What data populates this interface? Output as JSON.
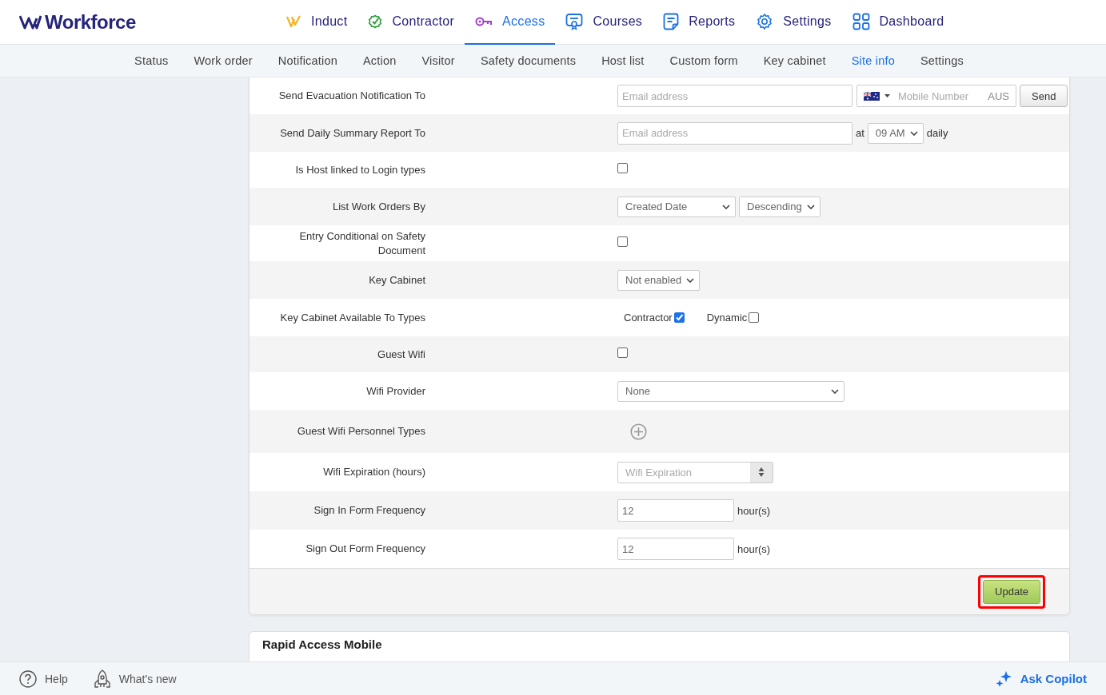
{
  "brand": {
    "name": "Workforce"
  },
  "top_nav": [
    {
      "kind": "induct",
      "label": "Induct",
      "selected": false
    },
    {
      "kind": "contractor",
      "label": "Contractor",
      "selected": false
    },
    {
      "kind": "access",
      "label": "Access",
      "selected": true
    },
    {
      "kind": "courses",
      "label": "Courses",
      "selected": false
    },
    {
      "kind": "reports",
      "label": "Reports",
      "selected": false
    },
    {
      "kind": "settings",
      "label": "Settings",
      "selected": false
    },
    {
      "kind": "dashboard",
      "label": "Dashboard",
      "selected": false
    }
  ],
  "sub_nav": [
    {
      "label": "Status",
      "selected": false
    },
    {
      "label": "Work order",
      "selected": false
    },
    {
      "label": "Notification",
      "selected": false
    },
    {
      "label": "Action",
      "selected": false
    },
    {
      "label": "Visitor",
      "selected": false
    },
    {
      "label": "Safety documents",
      "selected": false
    },
    {
      "label": "Host list",
      "selected": false
    },
    {
      "label": "Custom form",
      "selected": false
    },
    {
      "label": "Key cabinet",
      "selected": false
    },
    {
      "label": "Site info",
      "selected": true
    },
    {
      "label": "Settings",
      "selected": false
    }
  ],
  "form": {
    "rows": [
      {
        "kind": "email_phone",
        "label": "Send Evacuation Notification To",
        "email_placeholder": "Email address",
        "phone_placeholder": "Mobile Number",
        "country": "AUS",
        "button": "Send"
      },
      {
        "kind": "email_time",
        "label": "Send Daily Summary Report To",
        "email_placeholder": "Email address",
        "prefix": "at",
        "time": "09 AM",
        "suffix": "daily"
      },
      {
        "kind": "checkbox",
        "label": "Is Host linked to Login types",
        "checked": false
      },
      {
        "kind": "selects",
        "label": "List Work Orders By",
        "values": [
          "Created Date",
          "Descending"
        ]
      },
      {
        "kind": "checkbox",
        "label": "Entry Conditional on Safety Document",
        "checked": false
      },
      {
        "kind": "select",
        "label": "Key Cabinet",
        "value": "Not enabled"
      },
      {
        "kind": "checkboxes",
        "label": "Key Cabinet Available To Types",
        "items": [
          {
            "label": "Contractor",
            "checked": true
          },
          {
            "label": "Dynamic",
            "checked": false
          }
        ]
      },
      {
        "kind": "checkbox",
        "label": "Guest Wifi",
        "checked": false
      },
      {
        "kind": "wide_select",
        "label": "Wifi Provider",
        "value": "None"
      },
      {
        "kind": "add",
        "label": "Guest Wifi Personnel Types"
      },
      {
        "kind": "number",
        "label": "Wifi Expiration (hours)",
        "placeholder": "Wifi Expiration"
      },
      {
        "kind": "text_unit",
        "label": "Sign In Form Frequency",
        "value": "12",
        "unit": "hour(s)"
      },
      {
        "kind": "text_unit",
        "label": "Sign Out Form Frequency",
        "value": "12",
        "unit": "hour(s)"
      }
    ],
    "update_button": {
      "label": "Update",
      "highlighted": true
    }
  },
  "next_section": {
    "title": "Rapid Access Mobile"
  },
  "footer": {
    "help": "Help",
    "whats_new": "What's new",
    "copilot": "Ask Copilot"
  }
}
